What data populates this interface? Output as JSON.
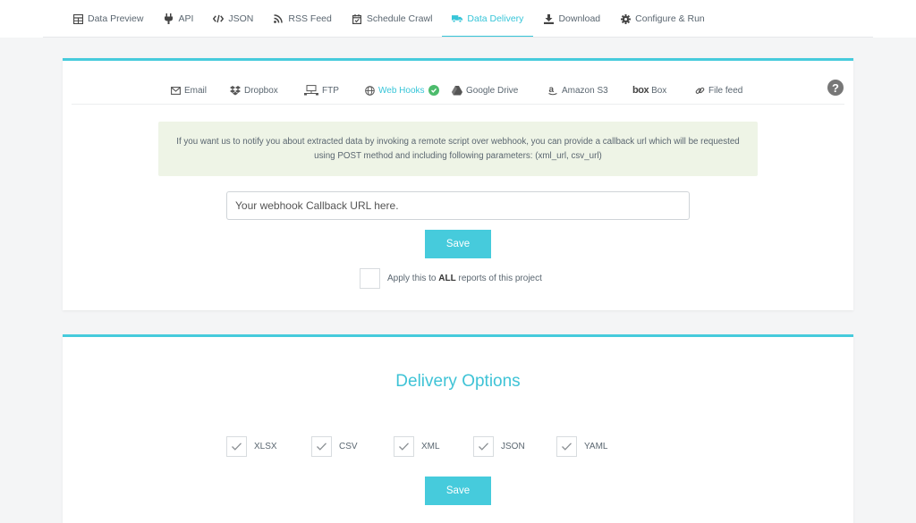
{
  "topnav": {
    "tabs": [
      {
        "label": "Data Preview",
        "icon": "table-icon"
      },
      {
        "label": "API",
        "icon": "plug-icon"
      },
      {
        "label": "JSON",
        "icon": "code-icon"
      },
      {
        "label": "RSS Feed",
        "icon": "rss-icon"
      },
      {
        "label": "Schedule Crawl",
        "icon": "calendar-check-icon"
      },
      {
        "label": "Data Delivery",
        "icon": "truck-icon",
        "active": true
      },
      {
        "label": "Download",
        "icon": "download-icon"
      },
      {
        "label": "Configure & Run",
        "icon": "gear-icon"
      }
    ]
  },
  "delivery_tabs": {
    "email": "Email",
    "dropbox": "Dropbox",
    "ftp": "FTP",
    "webhooks": "Web Hooks",
    "google_drive": "Google Drive",
    "amazon_s3": "Amazon S3",
    "box_logo": "box",
    "box": "Box",
    "file_feed": "File feed"
  },
  "help_label": "?",
  "webhook": {
    "info_text": "If you want us to notify you about extracted data by invoking a remote script over webhook, you can provide a callback url which will be requested using POST method and including following parameters: (xml_url, csv_url)",
    "placeholder": "Your webhook Callback URL here.",
    "save_label": "Save",
    "apply_prefix": "Apply this to",
    "apply_bold": "ALL",
    "apply_suffix": "reports of this project"
  },
  "delivery_options": {
    "title": "Delivery Options",
    "options": [
      {
        "label": "XLSX",
        "checked": true
      },
      {
        "label": "CSV",
        "checked": true
      },
      {
        "label": "XML",
        "checked": true
      },
      {
        "label": "JSON",
        "checked": true
      },
      {
        "label": "YAML",
        "checked": true
      }
    ],
    "save_label": "Save"
  },
  "colors": {
    "accent": "#46cbdc",
    "info_bg": "#eef4e6",
    "success": "#4cbb6c"
  }
}
